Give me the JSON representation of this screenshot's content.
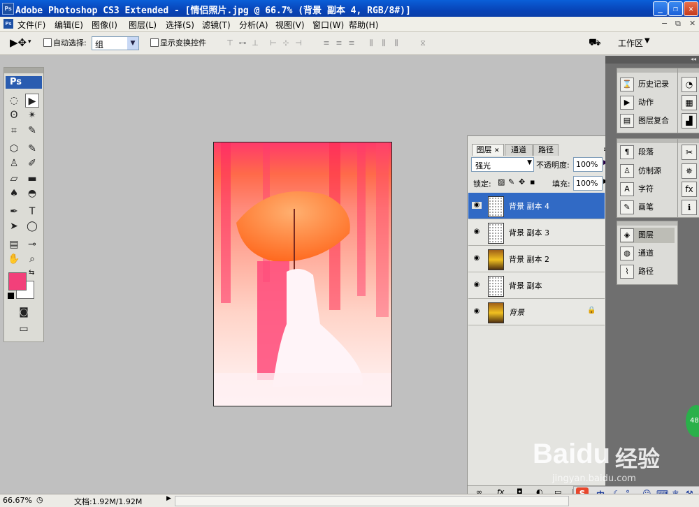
{
  "window": {
    "title": "Adobe Photoshop CS3 Extended - [情侣照片.jpg @ 66.7% (背景 副本 4, RGB/8#)]",
    "app_icon": "Ps"
  },
  "menubar": {
    "items": [
      "文件(F)",
      "编辑(E)",
      "图像(I)",
      "图层(L)",
      "选择(S)",
      "滤镜(T)",
      "分析(A)",
      "视图(V)",
      "窗口(W)",
      "帮助(H)"
    ]
  },
  "options": {
    "auto_select_label": "自动选择:",
    "auto_select_value": "组",
    "show_transform_label": "显示变换控件",
    "workspace_label": "工作区"
  },
  "toolbox": {
    "logo": "Ps"
  },
  "layers_panel": {
    "tabs": [
      "图层",
      "通道",
      "路径"
    ],
    "blend_mode": "强光",
    "opacity_label": "不透明度:",
    "opacity_value": "100%",
    "lock_label": "锁定:",
    "fill_label": "填充:",
    "fill_value": "100%",
    "layers": [
      {
        "name": "背景 副本 4",
        "selected": true
      },
      {
        "name": "背景 副本 3",
        "selected": false
      },
      {
        "name": "背景 副本 2",
        "selected": false
      },
      {
        "name": "背景 副本",
        "selected": false
      },
      {
        "name": "背景",
        "selected": false,
        "locked": true
      }
    ]
  },
  "dock": {
    "group1": [
      "历史记录",
      "动作",
      "图层复合"
    ],
    "group2": [
      "段落",
      "仿制源",
      "字符",
      "画笔"
    ],
    "group3": [
      "图层",
      "通道",
      "路径"
    ]
  },
  "status": {
    "zoom": "66.67%",
    "doc_info": "文档:1.92M/1.92M"
  },
  "watermark": {
    "brand": "Baidu",
    "cn": "经验",
    "url": "jingyan.baidu.com",
    "badge": "48"
  },
  "taskbar": {
    "ime": "中"
  },
  "colors": {
    "foreground": "#f2407a",
    "background": "#ffffff",
    "selection": "#316ac5",
    "titlebar": "#0a4fc8"
  }
}
